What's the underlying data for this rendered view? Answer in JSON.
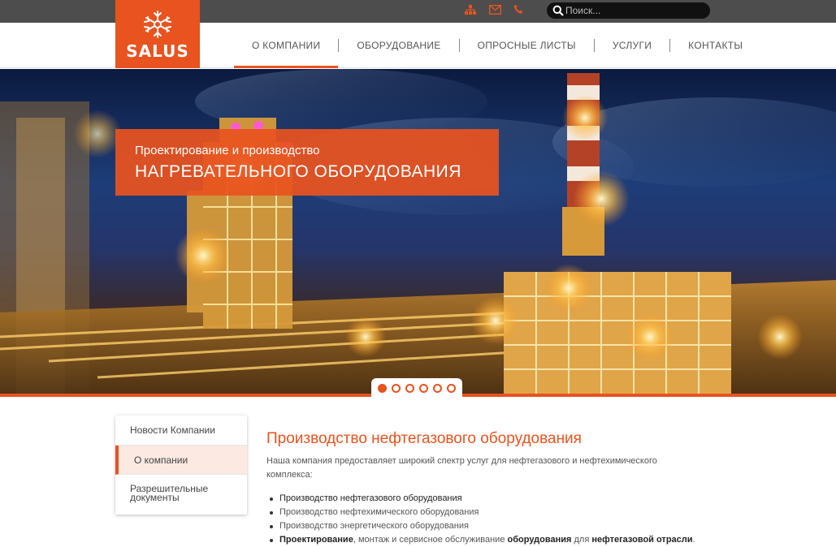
{
  "topbar": {
    "icons": [
      "sitemap-icon",
      "mail-icon",
      "phone-icon"
    ],
    "search": {
      "placeholder": "Поиск..."
    }
  },
  "logo": {
    "text": "SALUS"
  },
  "nav": {
    "items": [
      {
        "label": "О КОМПАНИИ",
        "active": true
      },
      {
        "label": "ОБОРУДОВАНИЕ",
        "active": false
      },
      {
        "label": "ОПРОСНЫЕ ЛИСТЫ",
        "active": false
      },
      {
        "label": "УСЛУГИ",
        "active": false
      },
      {
        "label": "КОНТАКТЫ",
        "active": false
      }
    ]
  },
  "hero": {
    "subtitle": "Проектирование и производство",
    "title": "НАГРЕВАТЕЛЬНОГО ОБОРУДОВАНИЯ",
    "slides_total": 6,
    "active_slide": 1
  },
  "sidebar": {
    "items": [
      {
        "label": "Новости Компании"
      },
      {
        "label": "О компании"
      },
      {
        "label_line1": "Разрешительные",
        "label_line2": "документы"
      }
    ]
  },
  "content": {
    "title": "Производство нефтегазового оборудования",
    "intro_line1": "Наша компания предоставляет широкий спектр услуг для нефтегазового и нефтехимического",
    "intro_line2": "комплекса:",
    "list": [
      {
        "text": "Производство нефтегазового оборудования"
      },
      {
        "text": "Производство нефтехимического оборудования"
      },
      {
        "text": "Производство энергетического оборудования"
      },
      {
        "p1": "Проектирование",
        "p2": ", монтаж и сервисное обслуживание ",
        "p3": "оборудования",
        "p4": " для ",
        "p5": "нефтегазовой отрасли",
        "p6": "."
      }
    ]
  },
  "colors": {
    "accent": "#e8531f",
    "topbar": "#4d4d4d",
    "text": "#555555"
  }
}
